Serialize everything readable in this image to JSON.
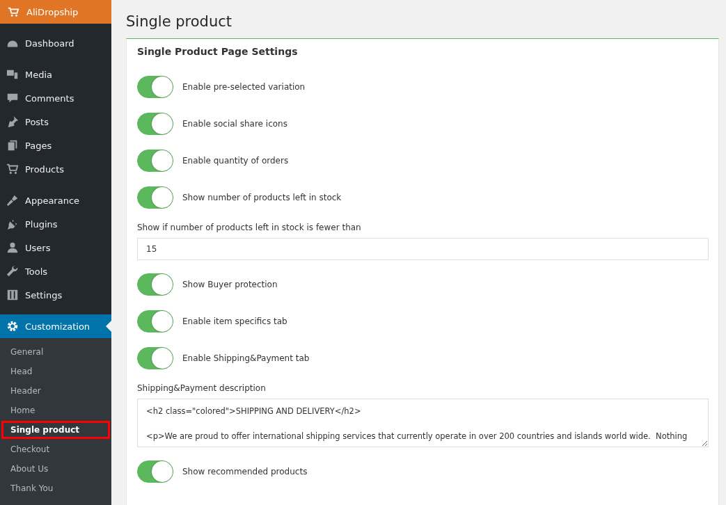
{
  "brand": {
    "title": "AliDropship"
  },
  "menu_groups": [
    {
      "items": [
        {
          "label": "Dashboard",
          "selected": false
        }
      ]
    },
    {
      "items": [
        {
          "label": "Media",
          "selected": false
        },
        {
          "label": "Comments",
          "selected": false
        },
        {
          "label": "Posts",
          "selected": false
        },
        {
          "label": "Pages",
          "selected": false
        },
        {
          "label": "Products",
          "selected": false
        }
      ]
    },
    {
      "items": [
        {
          "label": "Appearance",
          "selected": false
        },
        {
          "label": "Plugins",
          "selected": false
        },
        {
          "label": "Users",
          "selected": false
        },
        {
          "label": "Tools",
          "selected": false
        },
        {
          "label": "Settings",
          "selected": false
        }
      ]
    },
    {
      "items": [
        {
          "label": "Customization",
          "selected": true
        }
      ]
    }
  ],
  "submenu": [
    {
      "label": "General",
      "selected": false
    },
    {
      "label": "Head",
      "selected": false
    },
    {
      "label": "Header",
      "selected": false
    },
    {
      "label": "Home",
      "selected": false
    },
    {
      "label": "Single product",
      "selected": true
    },
    {
      "label": "Checkout",
      "selected": false
    },
    {
      "label": "About Us",
      "selected": false
    },
    {
      "label": "Thank You",
      "selected": false
    }
  ],
  "page_title": "Single product",
  "card_title": "Single Product Page Settings",
  "settings": [
    {
      "kind": "toggle",
      "label": "Enable pre-selected variation",
      "on": true
    },
    {
      "kind": "toggle",
      "label": "Enable social share icons",
      "on": true
    },
    {
      "kind": "toggle",
      "label": "Enable quantity of orders",
      "on": true
    },
    {
      "kind": "toggle",
      "label": "Show number of products left in stock",
      "on": true
    },
    {
      "kind": "field",
      "label": "Show if number of products left in stock is fewer than",
      "value": "15"
    },
    {
      "kind": "toggle",
      "label": "Show Buyer protection",
      "on": true
    },
    {
      "kind": "toggle",
      "label": "Enable item specifics tab",
      "on": true
    },
    {
      "kind": "toggle",
      "label": "Enable Shipping&Payment tab",
      "on": true
    },
    {
      "kind": "textarea",
      "label": "Shipping&Payment description",
      "value": "<h2 class=\"colored\">SHIPPING AND DELIVERY</h2>\n\n<p>We are proud to offer international shipping services that currently operate in over 200 countries and islands world wide.  Nothing"
    },
    {
      "kind": "toggle",
      "label": "Show recommended products",
      "on": true
    }
  ]
}
